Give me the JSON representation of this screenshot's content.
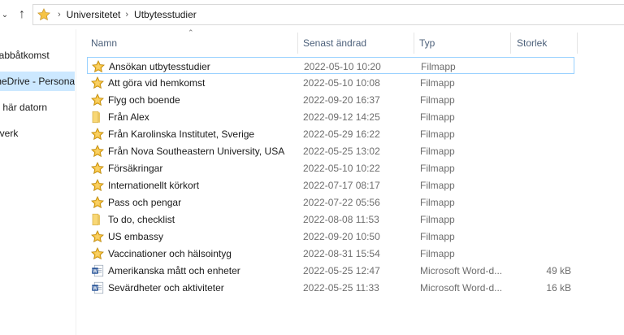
{
  "addressbar": {
    "breadcrumbs": [
      "Universitetet",
      "Utbytesstudier"
    ]
  },
  "sidebar": {
    "items": [
      {
        "label": "Snabbåtkomst",
        "selected": false
      },
      {
        "label": "OneDrive - Personal",
        "selected": true
      },
      {
        "label": "Den här datorn",
        "selected": false
      },
      {
        "label": "Nätverk",
        "selected": false
      }
    ]
  },
  "columns": {
    "name": "Namn",
    "date": "Senast ändrad",
    "type": "Typ",
    "size": "Storlek"
  },
  "files": [
    {
      "icon": "starred-folder-icon",
      "name": "Ansökan utbytesstudier",
      "date": "2022-05-10 10:20",
      "type": "Filmapp",
      "size": ""
    },
    {
      "icon": "starred-folder-icon",
      "name": "Att göra vid hemkomst",
      "date": "2022-05-10 10:08",
      "type": "Filmapp",
      "size": ""
    },
    {
      "icon": "starred-folder-icon",
      "name": "Flyg och boende",
      "date": "2022-09-20 16:37",
      "type": "Filmapp",
      "size": ""
    },
    {
      "icon": "folder-icon",
      "name": "Från Alex",
      "date": "2022-09-12 14:25",
      "type": "Filmapp",
      "size": ""
    },
    {
      "icon": "starred-folder-icon",
      "name": "Från Karolinska Institutet, Sverige",
      "date": "2022-05-29 16:22",
      "type": "Filmapp",
      "size": ""
    },
    {
      "icon": "starred-folder-icon",
      "name": "Från Nova Southeastern University, USA",
      "date": "2022-05-25 13:02",
      "type": "Filmapp",
      "size": ""
    },
    {
      "icon": "starred-folder-icon",
      "name": "Försäkringar",
      "date": "2022-05-10 10:22",
      "type": "Filmapp",
      "size": ""
    },
    {
      "icon": "starred-folder-icon",
      "name": "Internationellt körkort",
      "date": "2022-07-17 08:17",
      "type": "Filmapp",
      "size": ""
    },
    {
      "icon": "starred-folder-icon",
      "name": "Pass och pengar",
      "date": "2022-07-22 05:56",
      "type": "Filmapp",
      "size": ""
    },
    {
      "icon": "folder-icon",
      "name": "To do, checklist",
      "date": "2022-08-08 11:53",
      "type": "Filmapp",
      "size": ""
    },
    {
      "icon": "starred-folder-icon",
      "name": "US embassy",
      "date": "2022-09-20 10:50",
      "type": "Filmapp",
      "size": ""
    },
    {
      "icon": "starred-folder-icon",
      "name": "Vaccinationer och hälsointyg",
      "date": "2022-08-31 15:54",
      "type": "Filmapp",
      "size": ""
    },
    {
      "icon": "word-document-icon",
      "name": "Amerikanska mått och enheter",
      "date": "2022-05-25 12:47",
      "type": "Microsoft Word-d...",
      "size": "49 kB"
    },
    {
      "icon": "word-document-icon",
      "name": "Sevärdheter och aktiviteter",
      "date": "2022-05-25 11:33",
      "type": "Microsoft Word-d...",
      "size": "16 kB"
    }
  ],
  "colors": {
    "selected_bg": "#cce8ff",
    "focus_border": "#99d1ff",
    "header_text": "#4c607a",
    "folder_yellow": "#f8d775",
    "star_gold": "#f3b92e",
    "word_blue": "#2b579a"
  }
}
